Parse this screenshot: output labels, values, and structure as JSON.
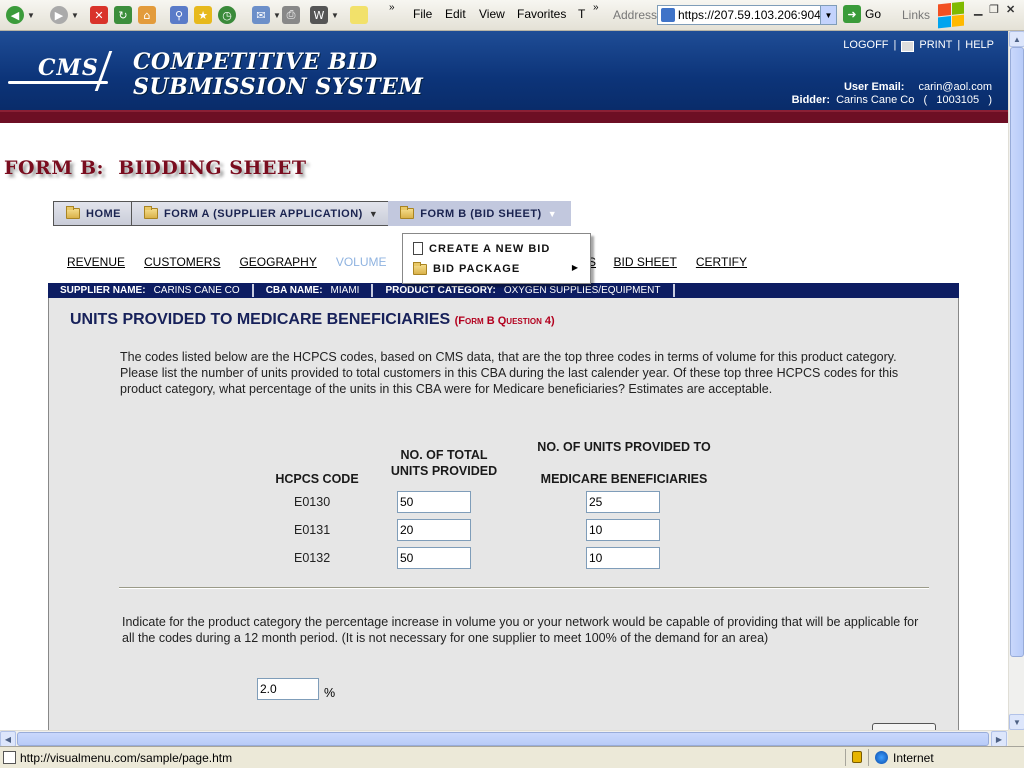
{
  "browser": {
    "menu": [
      "File",
      "Edit",
      "View",
      "Favorites",
      "T"
    ],
    "address_label": "Address",
    "url": "https://207.59.103.206:9045",
    "go_label": "Go",
    "links_label": "Links",
    "status_url": "http://visualmenu.com/sample/page.htm",
    "zone": "Internet"
  },
  "header": {
    "logo_text": "CMS",
    "title_line1": "COMPETITIVE BID",
    "title_line2": "SUBMISSION SYSTEM",
    "logoff": "LOGOFF",
    "print": "PRINT",
    "help": "HELP",
    "user_email_label": "User Email:",
    "user_email": "carin@aol.com",
    "bidder_label": "Bidder:",
    "bidder": "Carins Cane Co   (   1003105   )"
  },
  "page_title": "FORM B:  BIDDING SHEET",
  "tabs": [
    {
      "label": "HOME"
    },
    {
      "label": "FORM A (SUPPLIER APPLICATION)"
    },
    {
      "label": "FORM B (BID SHEET)"
    }
  ],
  "subnav": [
    {
      "label": "REVENUE"
    },
    {
      "label": "CUSTOMERS"
    },
    {
      "label": "GEOGRAPHY"
    },
    {
      "label": "VOLUME"
    },
    {
      "label": "EX"
    },
    {
      "label": "S"
    },
    {
      "label": "BID SHEET"
    },
    {
      "label": "CERTIFY"
    }
  ],
  "dropdown": {
    "item1": "CREATE A NEW BID",
    "item2": "BID PACKAGE"
  },
  "infobar": {
    "supplier_label": "SUPPLIER NAME:",
    "supplier": "CARINS CANE CO",
    "cba_label": "CBA NAME:",
    "cba": "MIAMI",
    "category_label": "PRODUCT CATEGORY:",
    "category": "OXYGEN SUPPLIES/EQUIPMENT"
  },
  "section": {
    "title": "UNITS PROVIDED TO MEDICARE BENEFICIARIES",
    "subtitle": "(Form B Question 4)",
    "intro": "The codes listed below are the HCPCS codes, based on CMS data, that are the top three codes in terms of volume for this product category. Please list the number of units provided to total customers in this CBA during the last calender year. Of these top three HCPCS codes for this product category, what percentage of the units in this CBA were for Medicare beneficiaries? Estimates are acceptable.",
    "col_code": "HCPCS CODE",
    "col_total_1": "NO. OF TOTAL",
    "col_total_2": "UNITS PROVIDED",
    "col_medicare_1": "NO. OF UNITS PROVIDED TO",
    "col_medicare_2": "MEDICARE BENEFICIARIES",
    "rows": [
      {
        "code": "E0130",
        "total": "50",
        "medicare": "25"
      },
      {
        "code": "E0131",
        "total": "20",
        "medicare": "10"
      },
      {
        "code": "E0132",
        "total": "50",
        "medicare": "10"
      }
    ],
    "increase_text": "Indicate for the product category the percentage increase in volume you or your network would be capable of providing that will be applicable for all the codes during a 12 month period. (It is not necessary for one supplier to meet 100% of the demand for an area)",
    "increase_value": "2.0",
    "percent_sign": "%"
  }
}
